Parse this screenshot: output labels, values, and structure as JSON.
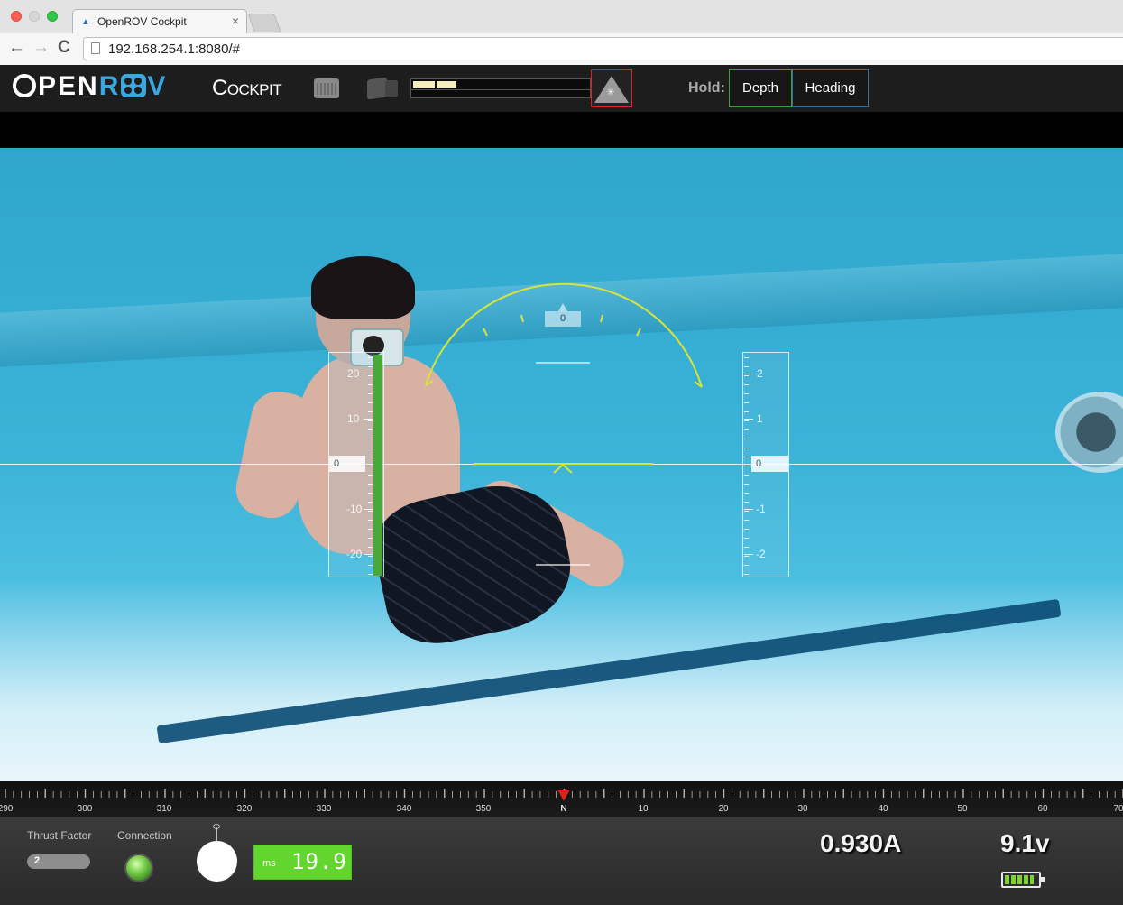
{
  "browser": {
    "tab_title": "OpenROV Cockpit",
    "tab_close": "×",
    "url": "192.168.254.1:8080/#",
    "back": "←",
    "forward": "→",
    "reload": "C"
  },
  "header": {
    "logo_o": "O",
    "logo_pen": "PEN",
    "logo_r": "R",
    "logo_v": "V",
    "app_title": "Cockpit",
    "keyboard_icon": "keyboard-icon",
    "camera_icon": "video-camera-icon",
    "link_quality_segments": 2,
    "laser_icon": "laser-warning-icon",
    "hold_label": "Hold:",
    "hold_depth_label": "Depth",
    "hold_heading_label": "Heading"
  },
  "hud": {
    "depth_ticks": [
      "20",
      "10",
      "0",
      "-10",
      "-20"
    ],
    "depth_value": "0",
    "pitch_ticks": [
      "2",
      "1",
      "0",
      "-1",
      "-2"
    ],
    "pitch_value": "0",
    "roll_value": "0",
    "accent_color": "#d7e33a",
    "depth_bar_color": "#4aa83a"
  },
  "compass": {
    "labels": [
      "290",
      "300",
      "310",
      "320",
      "330",
      "340",
      "350",
      "N",
      "10",
      "20",
      "30",
      "40",
      "50",
      "60",
      "70"
    ],
    "heading": "N",
    "marker_color": "#e02020"
  },
  "status": {
    "thrust_label": "Thrust Factor",
    "thrust_value": "2",
    "connection_label": "Connection",
    "latency_unit": "ms",
    "latency_value": "19.9",
    "current": "0.930A",
    "voltage": "9.1v",
    "battery_level": 0.9
  }
}
